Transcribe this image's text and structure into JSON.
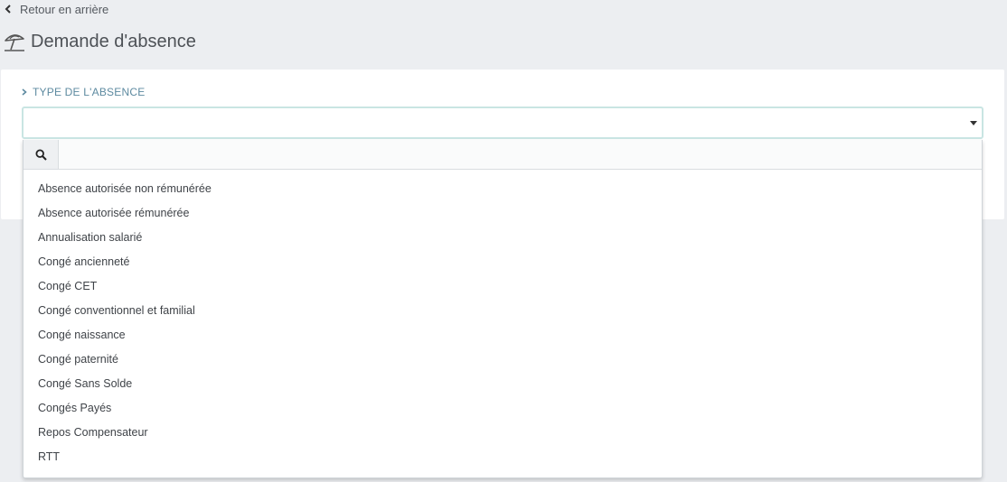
{
  "nav": {
    "back_label": "Retour en arrière"
  },
  "page": {
    "title": "Demande d'absence",
    "title_icon": "beach-umbrella-icon"
  },
  "form": {
    "field_label": "TYPE DE L'ABSENCE",
    "selected_value": "",
    "search_placeholder": "",
    "options": [
      {
        "label": "Absence autorisée non rémunérée"
      },
      {
        "label": "Absence autorisée rémunérée"
      },
      {
        "label": "Annualisation salarié"
      },
      {
        "label": "Congé ancienneté"
      },
      {
        "label": "Congé CET"
      },
      {
        "label": "Congé conventionnel et familial"
      },
      {
        "label": "Congé naissance"
      },
      {
        "label": "Congé paternité"
      },
      {
        "label": "Congé Sans Solde"
      },
      {
        "label": "Congés Payés"
      },
      {
        "label": "Repos Compensateur"
      },
      {
        "label": "RTT"
      }
    ]
  },
  "colors": {
    "background": "#eceef1",
    "label_accent": "#5d8aa0",
    "focus_border": "#c9e5e3",
    "teal_accent": "#3a9ca6"
  }
}
